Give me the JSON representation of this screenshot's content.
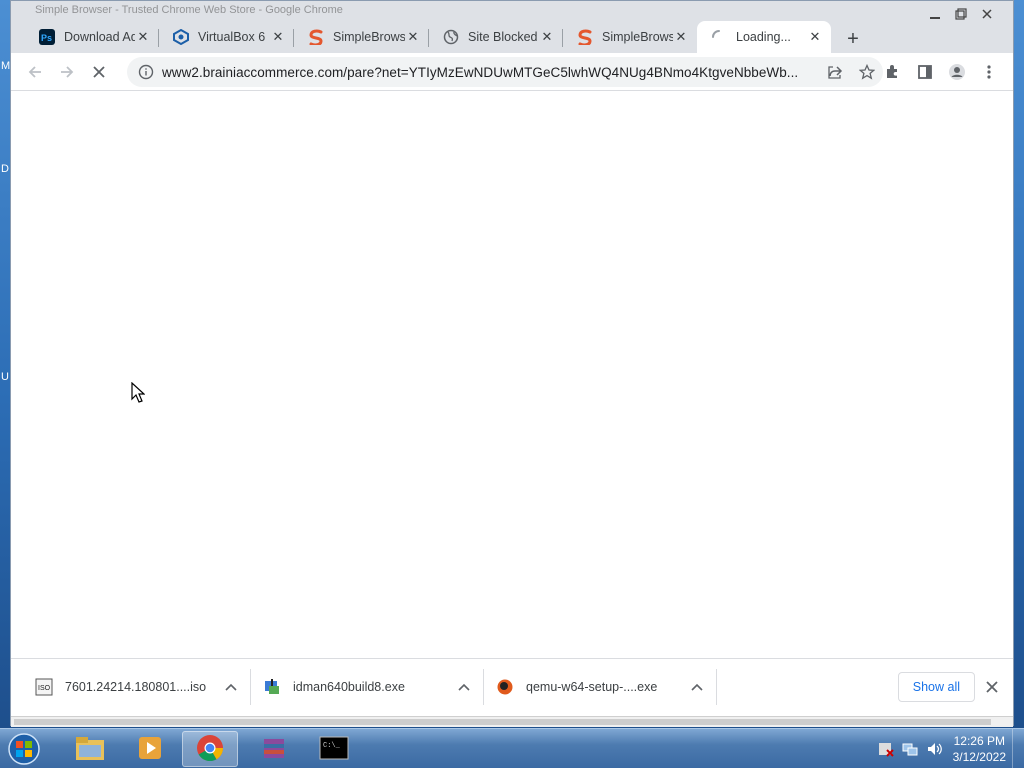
{
  "window": {
    "ghost_title": "Simple Browser - Trusted Chrome Web Store - Google Chrome"
  },
  "desktop": {
    "letters": [
      "M",
      "D",
      "U"
    ]
  },
  "tabs": [
    {
      "title": "Download Ad",
      "favicon": "photoshop-icon"
    },
    {
      "title": "VirtualBox 6",
      "favicon": "virtualbox-icon"
    },
    {
      "title": "SimpleBrows",
      "favicon": "simplebrowser-icon"
    },
    {
      "title": "Site Blocked",
      "favicon": "globe-icon"
    },
    {
      "title": "SimpleBrows",
      "favicon": "simplebrowser-icon"
    },
    {
      "title": "Loading...",
      "favicon": "loading-spinner-icon",
      "active": true
    }
  ],
  "toolbar": {
    "url": "www2.brainiaccommerce.com/pare?net=YTIyMzEwNDUwMTGeC5lwhWQ4NUg4BNmo4KtgveNbbeWb..."
  },
  "downloads": [
    {
      "name": "7601.24214.180801....iso",
      "icon": "iso-file-icon"
    },
    {
      "name": "idman640build8.exe",
      "icon": "installer-icon"
    },
    {
      "name": "qemu-w64-setup-....exe",
      "icon": "qemu-icon"
    }
  ],
  "download_bar": {
    "show_all": "Show all"
  },
  "taskbar": {
    "time": "12:26 PM",
    "date": "3/12/2022"
  }
}
